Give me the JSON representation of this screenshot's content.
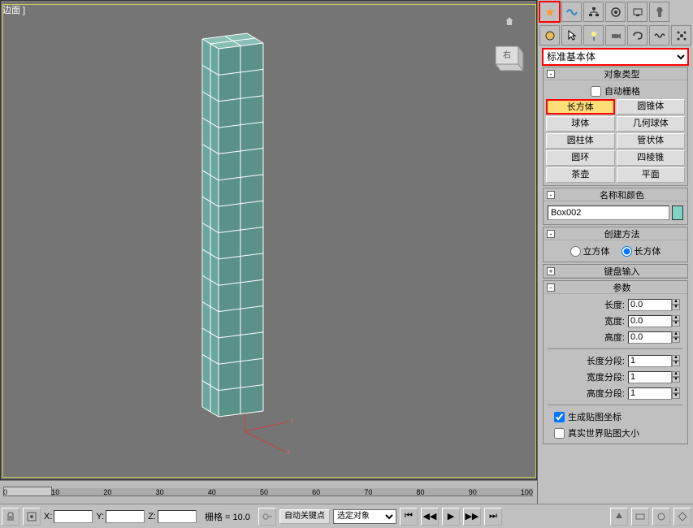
{
  "viewport": {
    "title": "边面 ]"
  },
  "side": {
    "dropdown": "标准基本体",
    "rollouts": {
      "object_type": {
        "title": "对象类型",
        "auto_grid": "自动栅格"
      },
      "name_color": {
        "title": "名称和颜色",
        "name_value": "Box002"
      },
      "create_method": {
        "title": "创建方法",
        "cube": "立方体",
        "box": "长方体"
      },
      "keyboard_entry": {
        "title": "键盘输入"
      },
      "params": {
        "title": "参数",
        "length": "长度:",
        "width": "宽度:",
        "height": "高度:",
        "length_segs": "长度分段:",
        "width_segs": "宽度分段:",
        "height_segs": "高度分段:",
        "gen_map": "生成贴图坐标",
        "real_world": "真实世界贴图大小",
        "length_val": "0.0",
        "width_val": "0.0",
        "height_val": "0.0",
        "length_segs_val": "1",
        "width_segs_val": "1",
        "height_segs_val": "1"
      }
    },
    "primitives": {
      "box": "长方体",
      "cone": "圆锥体",
      "sphere": "球体",
      "geosphere": "几何球体",
      "cylinder": "圆柱体",
      "tube": "管状体",
      "torus": "圆环",
      "pyramid": "四棱锥",
      "teapot": "茶壶",
      "plane": "平面"
    }
  },
  "timeline": {
    "ticks": [
      "0",
      "10",
      "20",
      "30",
      "40",
      "50",
      "60",
      "70",
      "80",
      "90",
      "100"
    ]
  },
  "bottom": {
    "x": "X:",
    "y": "Y:",
    "z": "Z:",
    "grid": "栅格 = 10.0",
    "auto_key": "自动关键点",
    "select_obj": "选定对象"
  }
}
